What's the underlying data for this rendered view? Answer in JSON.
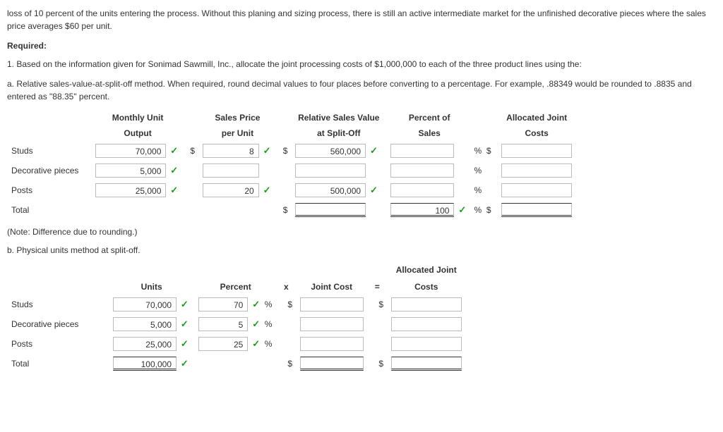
{
  "intro": {
    "para": "loss of 10 percent of the units entering the process. Without this planing and sizing process, there is still an active intermediate market for the unfinished decorative pieces where the sales price averages $60 per unit."
  },
  "required_label": "Required:",
  "q1": "1. Based on the information given for Sonimad Sawmill, Inc., allocate the joint processing costs of $1,000,000 to each of the three product lines using the:",
  "qa": "a. Relative sales-value-at-split-off method. When required, round decimal values to four places before converting to a percentage. For example, .88349 would be rounded to .8835 and entered as \"88.35\" percent.",
  "tableA": {
    "headers": {
      "col1a": "Monthly Unit",
      "col1b": "Output",
      "col2a": "Sales Price",
      "col2b": "per Unit",
      "col3a": "Relative Sales Value",
      "col3b": "at Split-Off",
      "col4a": "Percent of",
      "col4b": "Sales",
      "col5a": "Allocated Joint",
      "col5b": "Costs"
    },
    "rows": {
      "studs": {
        "label": "Studs",
        "output": "70,000",
        "price": "8",
        "value": "560,000",
        "percent": "",
        "cost": ""
      },
      "decorative": {
        "label": "Decorative pieces",
        "output": "5,000",
        "price": "",
        "value": "",
        "percent": "",
        "cost": ""
      },
      "posts": {
        "label": "Posts",
        "output": "25,000",
        "price": "20",
        "value": "500,000",
        "percent": "",
        "cost": ""
      },
      "total": {
        "label": "Total",
        "value": "",
        "percent": "100",
        "cost": ""
      }
    }
  },
  "note": "(Note: Difference due to rounding.)",
  "qb": "b. Physical units method at split-off.",
  "tableB": {
    "headers": {
      "units": "Units",
      "percent": "Percent",
      "x": "x",
      "jc": "Joint Cost",
      "eq": "=",
      "alloc1": "Allocated Joint",
      "alloc2": "Costs"
    },
    "rows": {
      "studs": {
        "label": "Studs",
        "units": "70,000",
        "percent": "70",
        "jc": "",
        "cost": ""
      },
      "decorative": {
        "label": "Decorative pieces",
        "units": "5,000",
        "percent": "5",
        "jc": "",
        "cost": ""
      },
      "posts": {
        "label": "Posts",
        "units": "25,000",
        "percent": "25",
        "jc": "",
        "cost": ""
      },
      "total": {
        "label": "Total",
        "units": "100,000",
        "jc": "",
        "cost": ""
      }
    }
  },
  "sym": {
    "dollar": "$",
    "pct": "%",
    "check": "✓",
    "x": "x",
    "eq": "="
  }
}
